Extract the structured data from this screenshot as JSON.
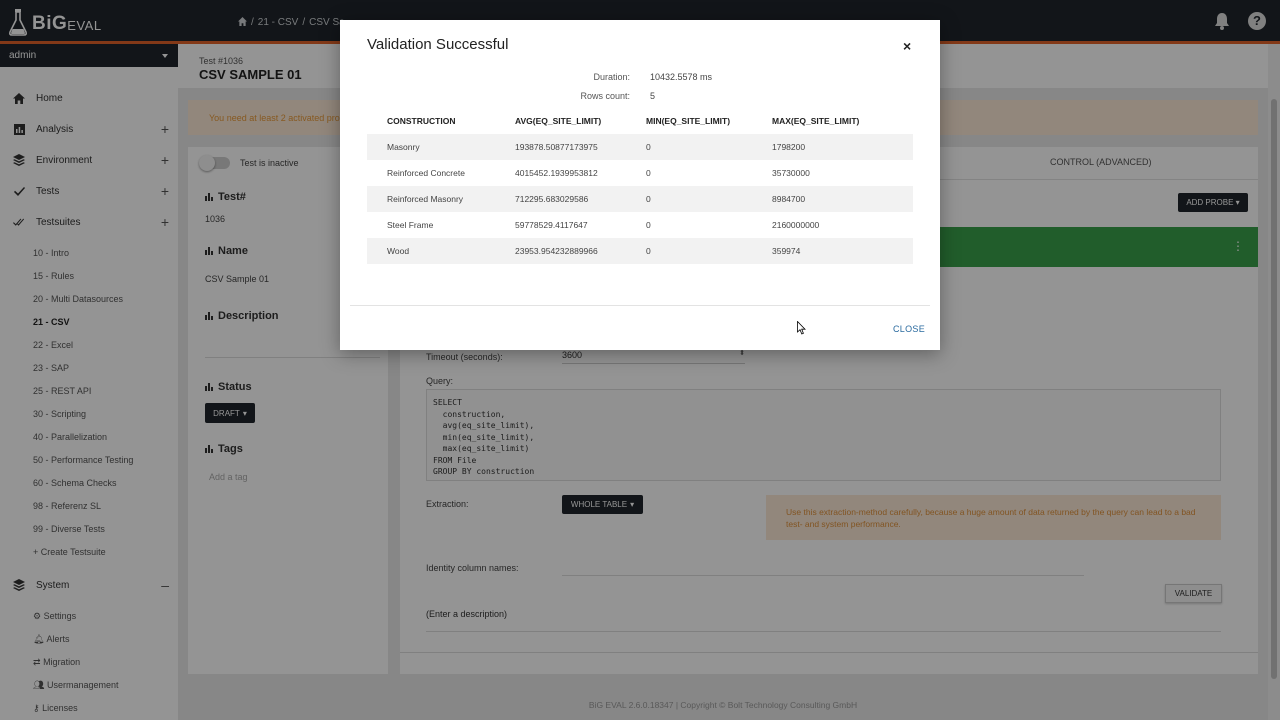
{
  "app": {
    "brand_big": "BiG",
    "brand_eval": "EVAL"
  },
  "breadcrumb": [
    "/",
    "21 - CSV",
    "/",
    "CSV Sa"
  ],
  "user": {
    "name": "admin"
  },
  "nav": {
    "home": "Home",
    "analysis": "Analysis",
    "environment": "Environment",
    "tests": "Tests",
    "testsuites": "Testsuites",
    "system": "System",
    "expand_symbol": "+",
    "collapse_symbol": "–"
  },
  "testsuites": [
    "10 - Intro",
    "15 - Rules",
    "20 - Multi Datasources",
    "21 - CSV",
    "22 - Excel",
    "23 - SAP",
    "25 - REST API",
    "30 - Scripting",
    "40 - Parallelization",
    "50 - Performance Testing",
    "60 - Schema Checks",
    "98 - Referenz SL",
    "99 - Diverse Tests",
    "+ Create Testsuite"
  ],
  "system_items": [
    "Settings",
    "Alerts",
    "Migration",
    "Usermanagement",
    "Licenses"
  ],
  "page": {
    "test_no": "Test #1036",
    "title": "CSV SAMPLE 01",
    "warning": "You need at least 2 activated prob",
    "inactive_label": "Test is inactive",
    "test_num_label": "Test#",
    "test_num_value": "1036",
    "name_label": "Name",
    "name_value": "CSV Sample 01",
    "description_label": "Description",
    "status_label": "Status",
    "status_value": "DRAFT",
    "tags_label": "Tags",
    "tags_placeholder": "Add a tag",
    "tab_control": "CONTROL (ADVANCED)",
    "add_probe": "ADD PROBE",
    "timeout_label": "Timeout (seconds):",
    "timeout_value": "3600",
    "query_label": "Query:",
    "query": "SELECT\n  construction,\n  avg(eq_site_limit),\n  min(eq_site_limit),\n  max(eq_site_limit)\nFROM File\nGROUP BY construction",
    "extraction_label": "Extraction:",
    "extraction_value": "WHOLE TABLE",
    "extraction_warning": "Use this extraction-method carefully, because a huge amount of data returned by the query can lead to a bad test- and system performance.",
    "identity_label": "Identity column names:",
    "validate": "VALIDATE",
    "enter_description": "(Enter a description)"
  },
  "footer": "BiG EVAL 2.6.0.18347 | Copyright © Bolt Technology Consulting GmbH",
  "modal": {
    "title": "Validation Successful",
    "close_x": "×",
    "duration_label": "Duration:",
    "duration_value": "10432.5578 ms",
    "rows_label": "Rows count:",
    "rows_value": "5",
    "columns": [
      "CONSTRUCTION",
      "AVG(EQ_SITE_LIMIT)",
      "MIN(EQ_SITE_LIMIT)",
      "MAX(EQ_SITE_LIMIT)"
    ],
    "rows": [
      [
        "Masonry",
        "193878.50877173975",
        "0",
        "1798200"
      ],
      [
        "Reinforced Concrete",
        "4015452.1939953812",
        "0",
        "35730000"
      ],
      [
        "Reinforced Masonry",
        "712295.683029586",
        "0",
        "8984700"
      ],
      [
        "Steel Frame",
        "59778529.4117647",
        "0",
        "2160000000"
      ],
      [
        "Wood",
        "23953.954232889966",
        "0",
        "359974"
      ]
    ],
    "close_button": "CLOSE"
  }
}
